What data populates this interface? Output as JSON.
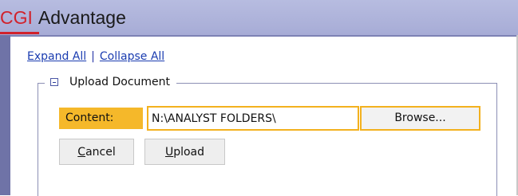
{
  "header": {
    "logo_cgi": "CGI",
    "logo_app": "Advantage"
  },
  "links": {
    "expand_all": "Expand All",
    "separator": "|",
    "collapse_all": "Collapse All"
  },
  "upload_section": {
    "legend": "Upload Document",
    "content_label": "Content:",
    "content_value": "N:\\ANALYST FOLDERS\\",
    "browse_label": "Browse...",
    "cancel_first": "C",
    "cancel_rest": "ancel",
    "upload_first": "U",
    "upload_rest": "pload"
  },
  "colors": {
    "header_bg": "#a7acd6",
    "logo_red": "#d1222c",
    "left_bar": "#6f73a7",
    "label_highlight": "#f5b82a",
    "link_blue": "#1a3cb0"
  }
}
